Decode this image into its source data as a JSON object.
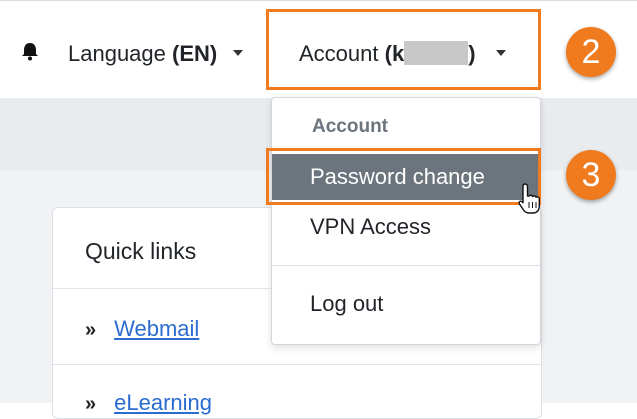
{
  "navbar": {
    "language_label": "Language",
    "language_code": "(EN)",
    "account_label": "Account",
    "account_user_prefix": "(k",
    "account_user_suffix": ")"
  },
  "dropdown": {
    "header": "Account",
    "items": [
      {
        "label": "Password change"
      },
      {
        "label": "VPN Access"
      },
      {
        "label": "Log out"
      }
    ]
  },
  "quick_links": {
    "title": "Quick links",
    "links": [
      {
        "label": "Webmail"
      },
      {
        "label": "eLearning"
      }
    ]
  },
  "steps": {
    "account_step": "2",
    "password_step": "3"
  },
  "colors": {
    "highlight": "#f07a1e",
    "active_item_bg": "#6c757d",
    "link": "#2b6cd1"
  },
  "icons": [
    "bell-icon",
    "caret-down-icon",
    "double-chevron-icon",
    "hand-pointer-icon"
  ]
}
